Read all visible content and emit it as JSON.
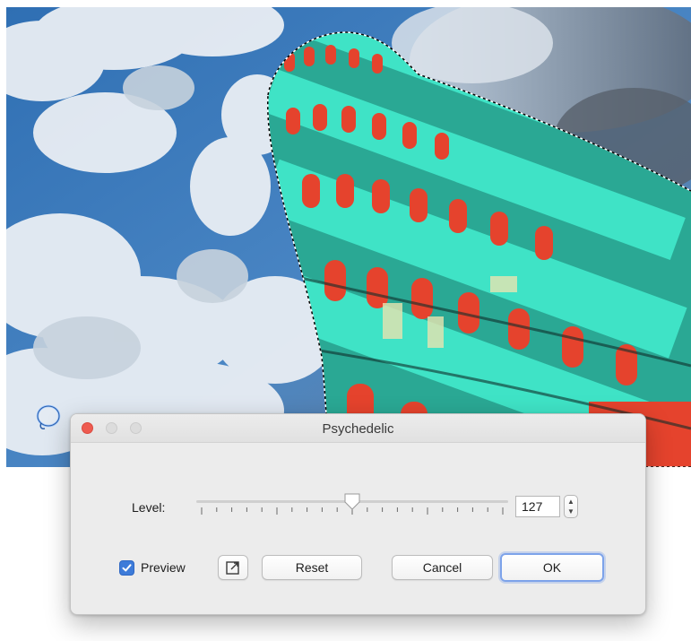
{
  "dialog": {
    "title": "Psychedelic",
    "level": {
      "label": "Level:",
      "value": "127",
      "slider_fraction": 0.5
    },
    "preview": {
      "label": "Preview",
      "checked": true
    },
    "buttons": {
      "reset": "Reset",
      "cancel": "Cancel",
      "ok": "OK"
    }
  },
  "icons": {
    "lasso_tool": "lasso-icon",
    "open_external": "open-in-window-icon",
    "stepper": "up-down-stepper-icon"
  },
  "colors": {
    "close": "#ee5b50",
    "checkbox": "#3d7bd9",
    "focus_ring": "#7da3ea",
    "effect_cyan": "#3fe3c6",
    "effect_red": "#e5432d"
  }
}
